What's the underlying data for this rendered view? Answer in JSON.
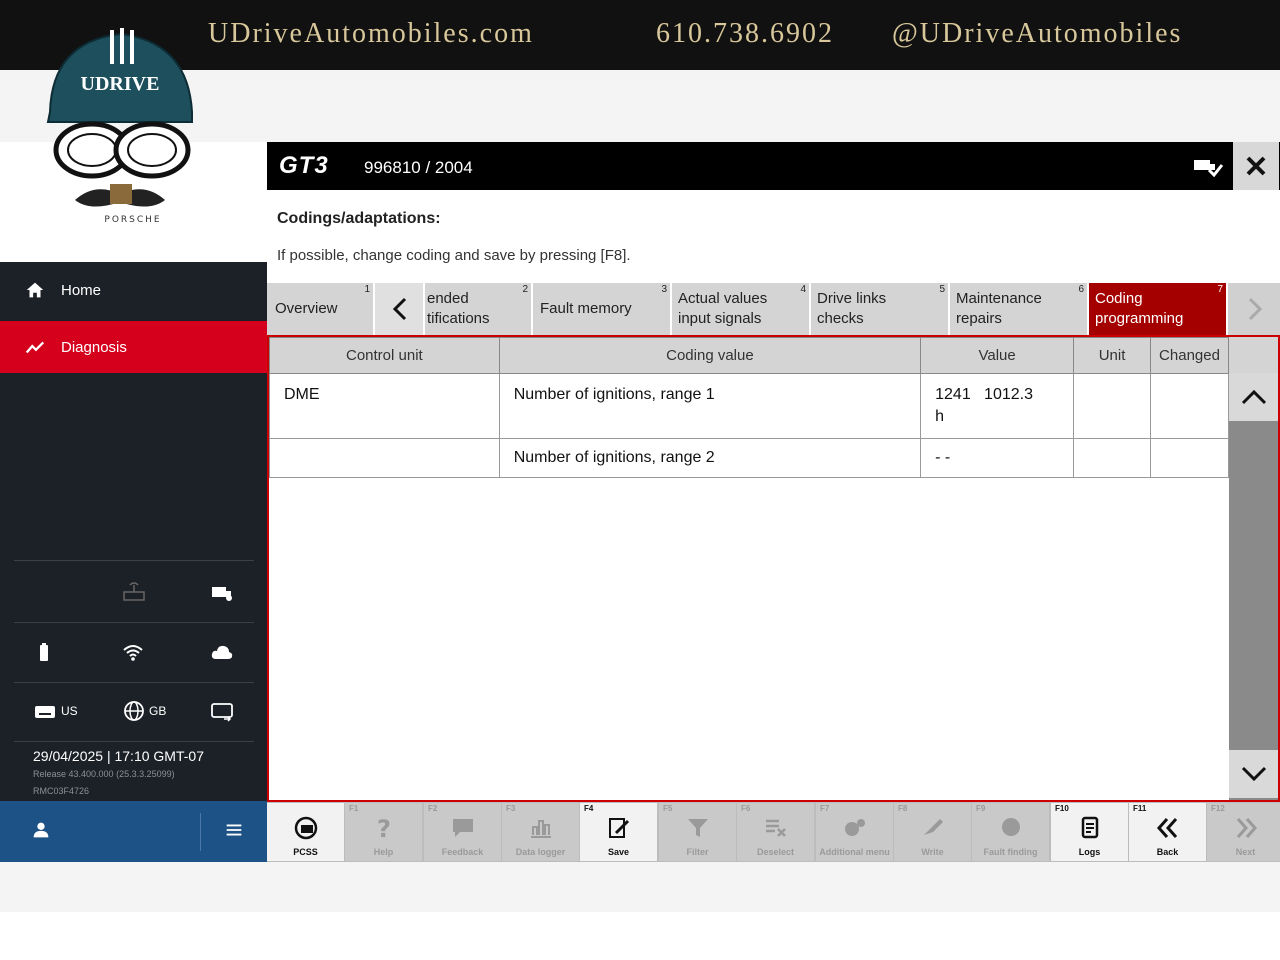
{
  "banner": {
    "website": "UDriveAutomobiles.com",
    "phone": "610.738.6902",
    "social": "@UDriveAutomobiles"
  },
  "logo": {
    "cap_text": "UDRIVE",
    "brand_text": "PORSCHE"
  },
  "header": {
    "model_logo": "GT3",
    "vehicle": "996810 / 2004"
  },
  "sidebar": {
    "nav": [
      {
        "label": "Home",
        "icon": "home-icon"
      },
      {
        "label": "Diagnosis",
        "icon": "diagnosis-icon"
      }
    ],
    "keyboard_lang": "US",
    "region": "GB",
    "datetime": "29/04/2025   |   17:10 GMT-07",
    "release": "Release 43.400.000 (25.3.3.25099)",
    "device_id": "RMC03F4726"
  },
  "page": {
    "title": "Codings/adaptations:",
    "hint": "If possible, change coding and save by pressing [F8]."
  },
  "tabs": [
    {
      "label": "Overview",
      "num": "1"
    },
    {
      "label": "ended\ntifications",
      "num": "2"
    },
    {
      "label": "Fault memory",
      "num": "3"
    },
    {
      "label": "Actual values\ninput signals",
      "num": "4"
    },
    {
      "label": "Drive links\nchecks",
      "num": "5"
    },
    {
      "label": "Maintenance\nrepairs",
      "num": "6"
    },
    {
      "label": "Coding\nprogramming",
      "num": "7"
    }
  ],
  "table": {
    "columns": [
      "Control unit",
      "Coding value",
      "Value",
      "Unit",
      "Changed"
    ],
    "rows": [
      {
        "control_unit": "DME",
        "coding_value": "Number of ignitions, range 1",
        "value": "1241   1012.3\nh",
        "unit": "",
        "changed": ""
      },
      {
        "control_unit": "",
        "coding_value": "Number of ignitions, range 2",
        "value": "- -",
        "unit": "",
        "changed": ""
      }
    ]
  },
  "toolbar": [
    {
      "key": "",
      "label": "PCSS",
      "enabled": true
    },
    {
      "key": "F1",
      "label": "Help",
      "enabled": false
    },
    {
      "key": "F2",
      "label": "Feedback",
      "enabled": false
    },
    {
      "key": "F3",
      "label": "Data logger",
      "enabled": false
    },
    {
      "key": "F4",
      "label": "Save",
      "enabled": true
    },
    {
      "key": "F5",
      "label": "Filter",
      "enabled": false
    },
    {
      "key": "F6",
      "label": "Deselect",
      "enabled": false
    },
    {
      "key": "F7",
      "label": "Additional menu",
      "enabled": false
    },
    {
      "key": "F8",
      "label": "Write",
      "enabled": false
    },
    {
      "key": "F9",
      "label": "Fault finding",
      "enabled": false
    },
    {
      "key": "F10",
      "label": "Logs",
      "enabled": true
    },
    {
      "key": "F11",
      "label": "Back",
      "enabled": true
    },
    {
      "key": "F12",
      "label": "Next",
      "enabled": false
    }
  ],
  "colors": {
    "accent_red": "#d5001c",
    "active_tab": "#a50000",
    "sidebar_bg": "#1c2127",
    "banner_text": "#d8c79a"
  }
}
